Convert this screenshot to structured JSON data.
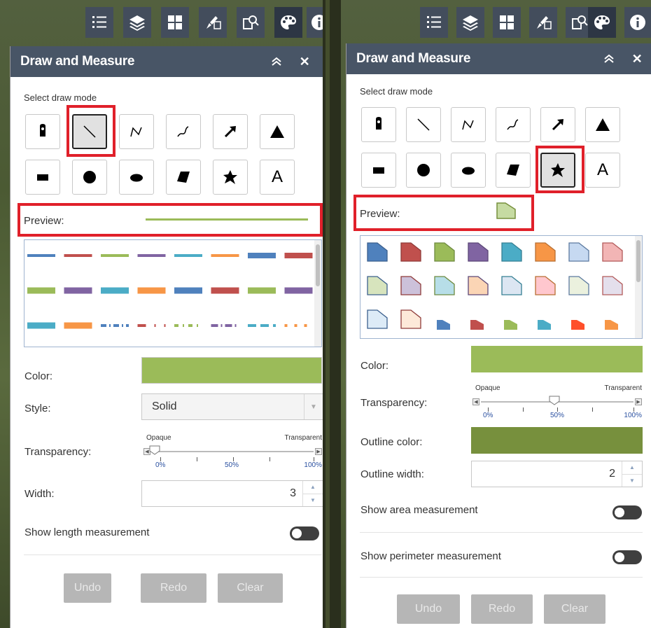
{
  "toolbar_icons": [
    "list-icon",
    "layers-icon",
    "basemap-gallery-icon",
    "edit-icon",
    "query-icon",
    "draw-measure-icon",
    "info-icon"
  ],
  "left": {
    "header": {
      "title": "Draw and Measure"
    },
    "select_draw_mode_label": "Select draw mode",
    "preview_label": "Preview:",
    "color_label": "Color:",
    "color_value": "#9bbb59",
    "style_label": "Style:",
    "style_value": "Solid",
    "transparency_label": "Transparency:",
    "slider": {
      "opaque": "Opaque",
      "transparent": "Transparent",
      "p0": "0%",
      "p50": "50%",
      "p100": "100%",
      "value_percent": 0
    },
    "width_label": "Width:",
    "width_value": "3",
    "show_length_label": "Show length measurement",
    "buttons": {
      "undo": "Undo",
      "redo": "Redo",
      "clear": "Clear"
    },
    "selected_mode": "line"
  },
  "right": {
    "header": {
      "title": "Draw and Measure"
    },
    "select_draw_mode_label": "Select draw mode",
    "preview_label": "Preview:",
    "color_label": "Color:",
    "color_value": "#9bbb59",
    "transparency_label": "Transparency:",
    "slider": {
      "opaque": "Opaque",
      "transparent": "Transparent",
      "p0": "0%",
      "p50": "50%",
      "p100": "100%",
      "value_percent": 50
    },
    "outline_color_label": "Outline color:",
    "outline_color_value": "#77903d",
    "outline_width_label": "Outline width:",
    "outline_width_value": "2",
    "show_area_label": "Show area measurement",
    "show_perimeter_label": "Show perimeter measurement",
    "buttons": {
      "undo": "Undo",
      "redo": "Redo",
      "clear": "Clear"
    },
    "selected_mode": "freehand-polygon"
  },
  "draw_modes": [
    "point",
    "line",
    "polyline",
    "freehand-polyline",
    "arrow",
    "triangle",
    "extent",
    "circle",
    "ellipse",
    "polygon",
    "freehand-polygon",
    "text"
  ],
  "text_mode_glyph": "A",
  "line_swatch_colors": [
    "#4f81bd",
    "#c0504d",
    "#9bbb59",
    "#8064a2",
    "#4bacc6",
    "#f79646"
  ],
  "fill_swatch_colors": [
    "#4f81bd",
    "#c0504d",
    "#9bbb59",
    "#8064a2",
    "#4bacc6",
    "#f79646",
    "#c6d9f1",
    "#f2b5b5",
    "#d7e4bd",
    "#ccc1da",
    "#b7dee8",
    "#fbd5b5",
    "#dce6f2",
    "#ffc7ce",
    "#ebf1de",
    "#e4dfec",
    "#ddebf7",
    "#fde9d9",
    "#ff4f2a"
  ]
}
